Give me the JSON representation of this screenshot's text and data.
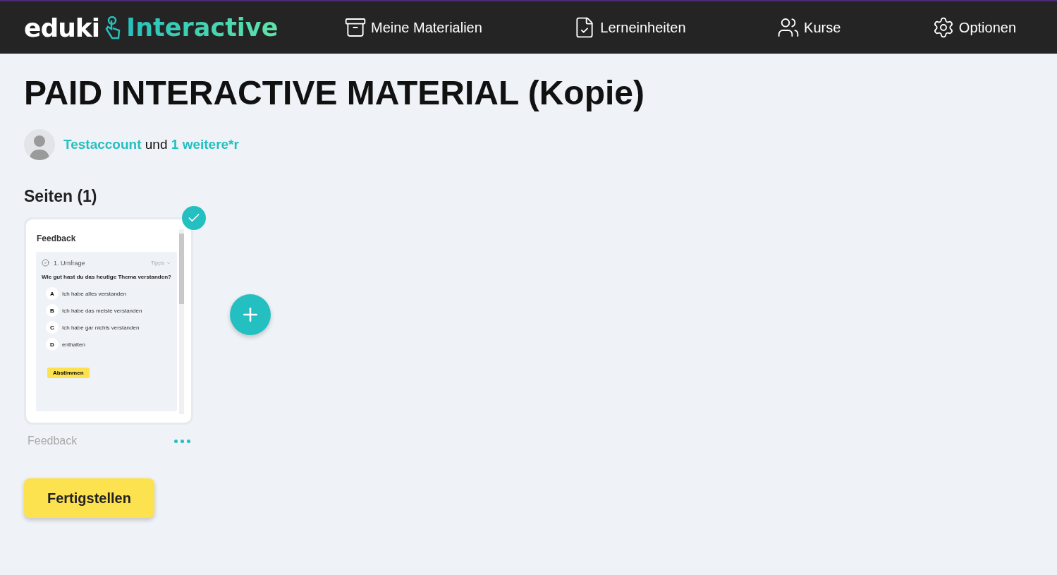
{
  "header": {
    "logo_brand": "eduki",
    "logo_product": "Interactive",
    "nav": [
      {
        "kind": "materials",
        "label": "Meine Materialien"
      },
      {
        "kind": "units",
        "label": "Lerneinheiten"
      },
      {
        "kind": "courses",
        "label": "Kurse"
      },
      {
        "kind": "options",
        "label": "Optionen"
      }
    ]
  },
  "title": "PAID INTERACTIVE MATERIAL (Kopie)",
  "authors": {
    "author": "Testaccount",
    "conjunction": "und",
    "others": "1 weitere*r"
  },
  "pages_heading": "Seiten (1)",
  "pages": [
    {
      "selected": true,
      "name": "Feedback",
      "preview": {
        "title": "Feedback",
        "task": "1. Umfrage",
        "hint": "Tipps",
        "question": "Wie gut hast du das heutige Thema verstanden?",
        "options": [
          {
            "letter": "A",
            "text": "Ich habe alles verstanden"
          },
          {
            "letter": "B",
            "text": "Ich habe das meiste verstanden"
          },
          {
            "letter": "C",
            "text": "Ich habe gar nichts verstanden"
          },
          {
            "letter": "D",
            "text": "enthalten"
          }
        ],
        "submit": "Abstimmen"
      }
    }
  ],
  "finish_button": "Fertigstellen"
}
